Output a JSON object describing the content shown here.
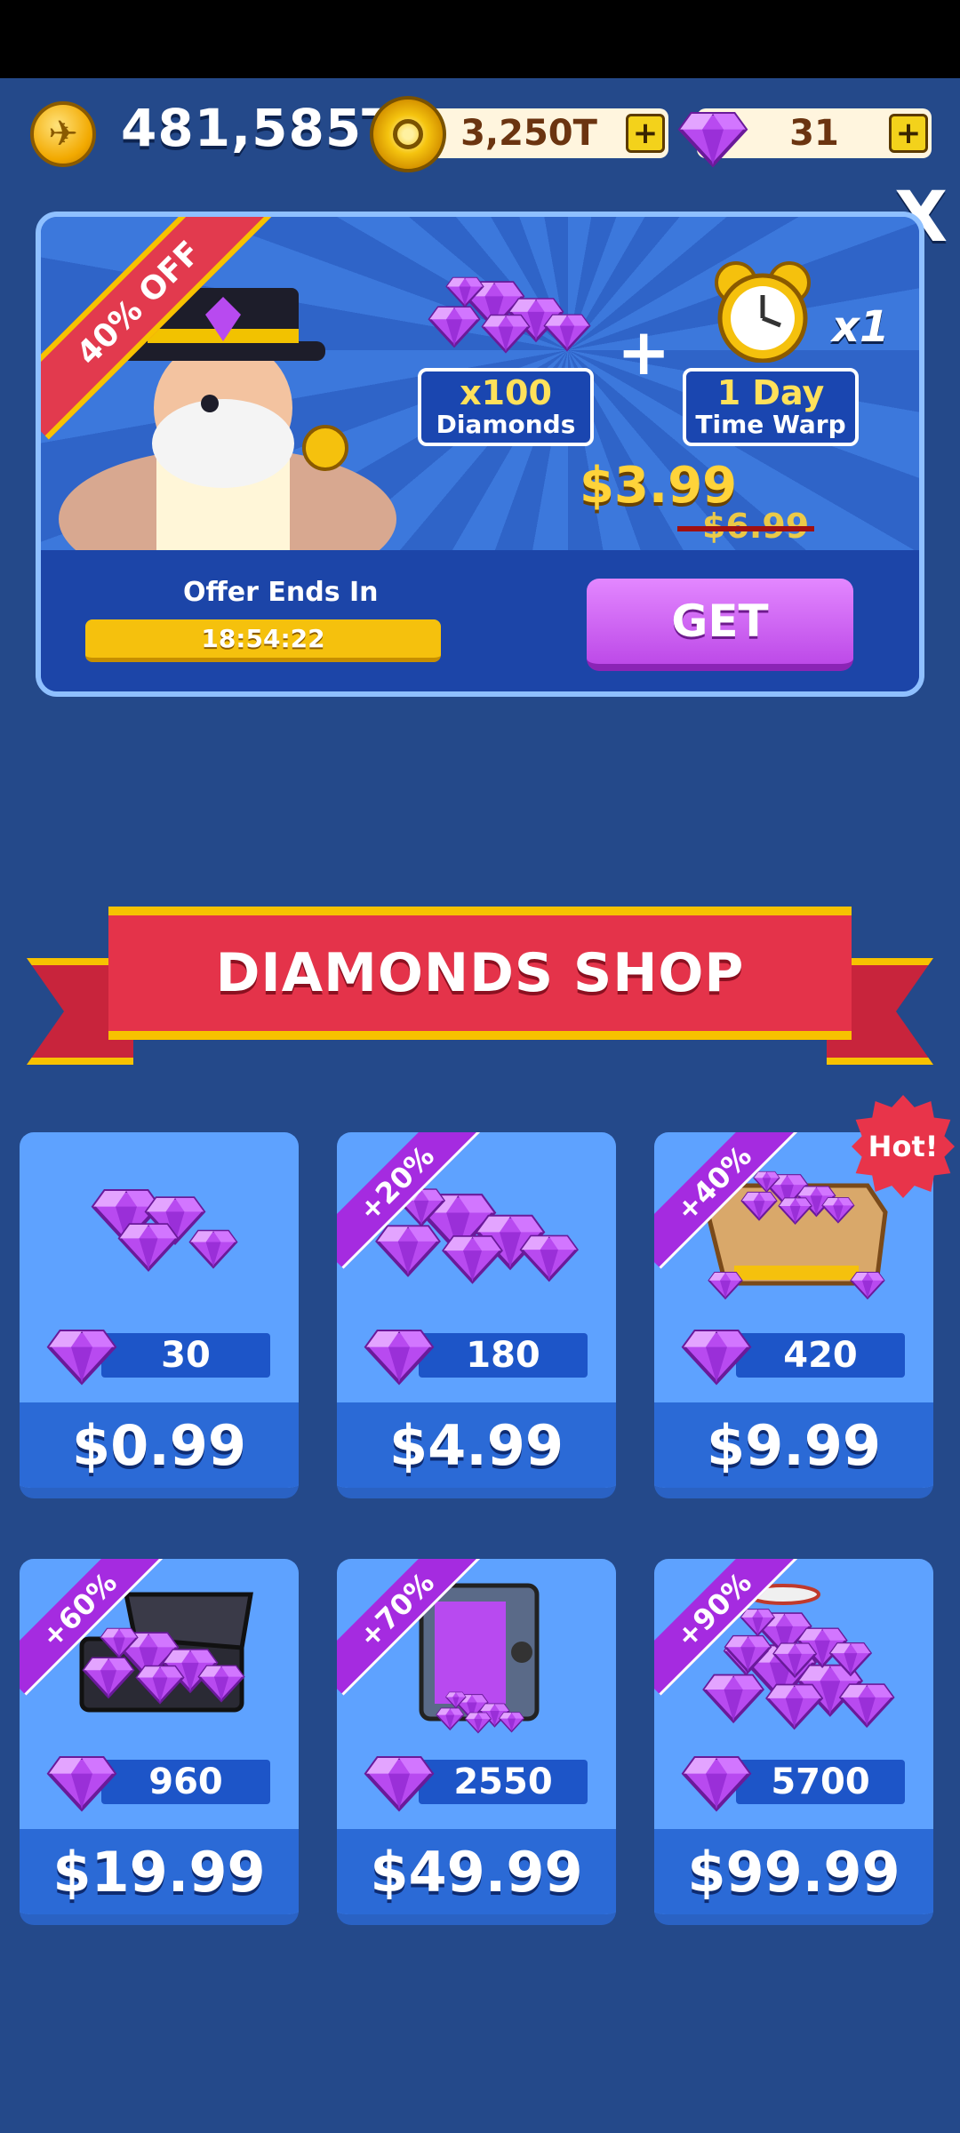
{
  "header": {
    "balance": "481,585T",
    "time_warp_value": "3,250T",
    "diamond_value": "31",
    "plus_label": "+",
    "close_label": "X"
  },
  "offer": {
    "ribbon": "40% OFF",
    "item1_big": "x100",
    "item1_small": "Diamonds",
    "item2_big": "1 Day",
    "item2_small": "Time Warp",
    "plus": "+",
    "multiplier": "x1",
    "price_now": "$3.99",
    "price_old": "$6.99",
    "ends_label": "Offer Ends In",
    "timer": "18:54:22",
    "get_label": "GET"
  },
  "shop": {
    "title": "DIAMONDS SHOP",
    "hot_badge": "Hot!",
    "packs": [
      {
        "bonus": "",
        "count": "30",
        "price": "$0.99"
      },
      {
        "bonus": "+20%",
        "count": "180",
        "price": "$4.99"
      },
      {
        "bonus": "+40%",
        "count": "420",
        "price": "$9.99"
      },
      {
        "bonus": "+60%",
        "count": "960",
        "price": "$19.99"
      },
      {
        "bonus": "+70%",
        "count": "2550",
        "price": "$49.99"
      },
      {
        "bonus": "+90%",
        "count": "5700",
        "price": "$99.99"
      }
    ]
  },
  "colors": {
    "background": "#24498a",
    "gem": "#b040e8",
    "accent_gold": "#f5c10d",
    "banner_red": "#e4334a"
  }
}
